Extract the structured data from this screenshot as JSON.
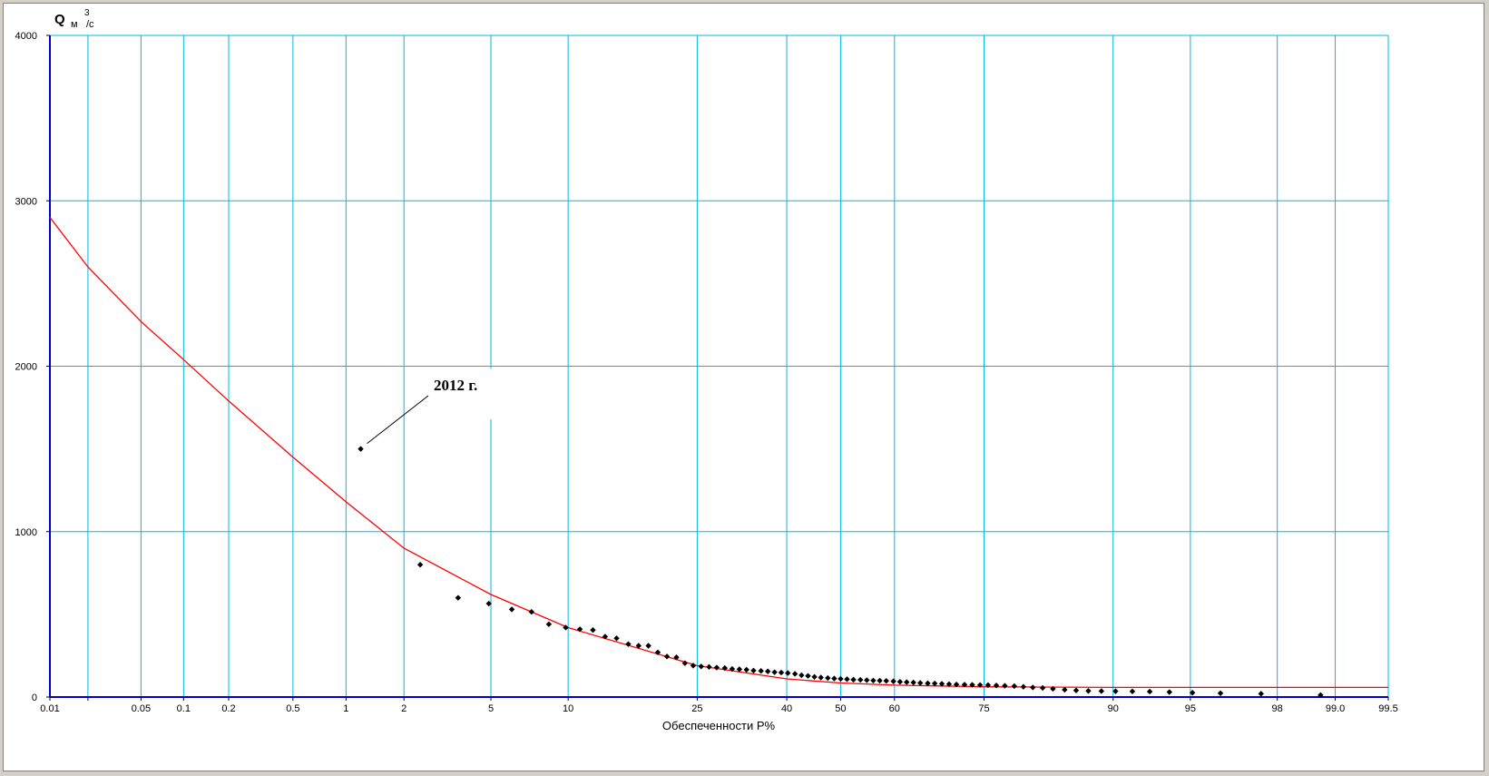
{
  "colors": {
    "grid": "#00b8e6",
    "fit_curve": "#ff0000",
    "points": "#000000",
    "axis": "#0000cc"
  },
  "chart_data": {
    "type": "scatter",
    "x_scale": "probability",
    "ylabel_main": "Q",
    "ylabel_unit_m": "м",
    "ylabel_unit_exp": "3",
    "ylabel_unit_s": "/с",
    "xlabel": "Обеспеченности P%",
    "ylim": [
      0,
      4000
    ],
    "y_ticks": [
      {
        "value": 0,
        "label": "0"
      },
      {
        "value": 1000,
        "label": "1000"
      },
      {
        "value": 2000,
        "label": "2000"
      },
      {
        "value": 3000,
        "label": "3000"
      },
      {
        "value": 4000,
        "label": "4000"
      }
    ],
    "x_ticks": [
      {
        "p": 0.01,
        "label": "0.01"
      },
      {
        "p": 0.02,
        "label": ""
      },
      {
        "p": 0.05,
        "label": "0.05"
      },
      {
        "p": 0.1,
        "label": "0.1"
      },
      {
        "p": 0.2,
        "label": "0.2"
      },
      {
        "p": 0.5,
        "label": "0.5"
      },
      {
        "p": 1,
        "label": "1"
      },
      {
        "p": 2,
        "label": "2"
      },
      {
        "p": 5,
        "label": "5"
      },
      {
        "p": 10,
        "label": "10"
      },
      {
        "p": 25,
        "label": "25"
      },
      {
        "p": 40,
        "label": "40"
      },
      {
        "p": 50,
        "label": "50"
      },
      {
        "p": 60,
        "label": "60"
      },
      {
        "p": 75,
        "label": "75"
      },
      {
        "p": 90,
        "label": "90"
      },
      {
        "p": 95,
        "label": "95"
      },
      {
        "p": 98,
        "label": "98"
      },
      {
        "p": 99,
        "label": "99.0"
      },
      {
        "p": 99.5,
        "label": "99.5"
      }
    ],
    "annotation": {
      "text": "2012 г.",
      "p": 1.2,
      "q": 1500
    },
    "series": [
      {
        "type": "line",
        "points": [
          [
            0.01,
            2900
          ],
          [
            0.02,
            2600
          ],
          [
            0.05,
            2270
          ],
          [
            0.1,
            2040
          ],
          [
            0.2,
            1790
          ],
          [
            0.5,
            1450
          ],
          [
            1,
            1180
          ],
          [
            2,
            900
          ],
          [
            5,
            620
          ],
          [
            10,
            420
          ],
          [
            25,
            190
          ],
          [
            40,
            110
          ],
          [
            50,
            85
          ],
          [
            60,
            72
          ],
          [
            75,
            62
          ],
          [
            90,
            58
          ],
          [
            95,
            58
          ],
          [
            98,
            58
          ],
          [
            99,
            58
          ],
          [
            99.5,
            58
          ]
        ]
      },
      {
        "type": "scatter",
        "points": [
          [
            1.2,
            1500
          ],
          [
            2.4,
            800
          ],
          [
            3.6,
            600
          ],
          [
            4.9,
            565
          ],
          [
            6.1,
            530
          ],
          [
            7.3,
            515
          ],
          [
            8.5,
            440
          ],
          [
            9.8,
            420
          ],
          [
            11,
            410
          ],
          [
            12.2,
            405
          ],
          [
            13.4,
            365
          ],
          [
            14.6,
            355
          ],
          [
            15.9,
            320
          ],
          [
            17.1,
            310
          ],
          [
            18.3,
            310
          ],
          [
            19.5,
            270
          ],
          [
            20.7,
            245
          ],
          [
            22,
            240
          ],
          [
            23.2,
            205
          ],
          [
            24.4,
            190
          ],
          [
            25.6,
            185
          ],
          [
            26.8,
            182
          ],
          [
            28,
            178
          ],
          [
            29.3,
            175
          ],
          [
            30.5,
            170
          ],
          [
            31.7,
            168
          ],
          [
            32.9,
            165
          ],
          [
            34.1,
            160
          ],
          [
            35.4,
            158
          ],
          [
            36.6,
            155
          ],
          [
            37.8,
            150
          ],
          [
            39,
            148
          ],
          [
            40.2,
            145
          ],
          [
            41.5,
            140
          ],
          [
            42.7,
            132
          ],
          [
            43.9,
            128
          ],
          [
            45.1,
            122
          ],
          [
            46.3,
            118
          ],
          [
            47.6,
            115
          ],
          [
            48.8,
            112
          ],
          [
            50,
            110
          ],
          [
            51.2,
            108
          ],
          [
            52.4,
            105
          ],
          [
            53.7,
            104
          ],
          [
            54.9,
            102
          ],
          [
            56.1,
            100
          ],
          [
            57.3,
            99
          ],
          [
            58.5,
            98
          ],
          [
            59.8,
            95
          ],
          [
            61,
            92
          ],
          [
            62.2,
            90
          ],
          [
            63.4,
            88
          ],
          [
            64.6,
            85
          ],
          [
            65.9,
            83
          ],
          [
            67.1,
            82
          ],
          [
            68.3,
            80
          ],
          [
            69.5,
            78
          ],
          [
            70.7,
            76
          ],
          [
            72,
            75
          ],
          [
            73.2,
            74
          ],
          [
            74.4,
            73
          ],
          [
            75.6,
            72
          ],
          [
            76.8,
            70
          ],
          [
            78,
            68
          ],
          [
            79.3,
            66
          ],
          [
            80.5,
            62
          ],
          [
            81.7,
            58
          ],
          [
            82.9,
            55
          ],
          [
            84.1,
            50
          ],
          [
            85.4,
            44
          ],
          [
            86.6,
            40
          ],
          [
            87.8,
            37
          ],
          [
            89,
            36
          ],
          [
            90.2,
            35
          ],
          [
            91.5,
            34
          ],
          [
            92.7,
            33
          ],
          [
            93.9,
            30
          ],
          [
            95.1,
            26
          ],
          [
            96.3,
            23
          ],
          [
            97.6,
            20
          ],
          [
            98.8,
            12
          ]
        ]
      }
    ]
  }
}
